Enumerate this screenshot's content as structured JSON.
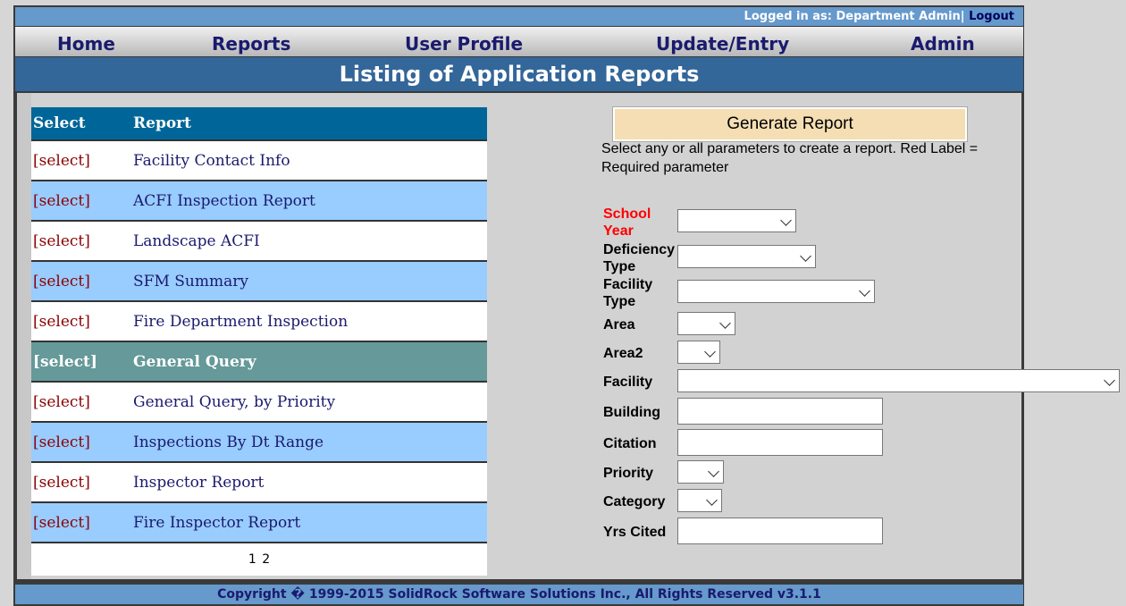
{
  "header": {
    "login_text": "Logged in as: Department Admin|",
    "logout": "Logout"
  },
  "nav": [
    "Home",
    "Reports",
    "User Profile",
    "Update/Entry",
    "Admin"
  ],
  "title": "Listing of Application Reports",
  "reports_table": {
    "headers": [
      "Select",
      "Report"
    ],
    "select_label": "[select]",
    "rows": [
      "Facility Contact Info",
      "ACFI Inspection Report",
      "Landscape ACFI",
      "SFM Summary",
      "Fire Department Inspection",
      "General Query",
      "General Query, by Priority",
      "Inspections By Dt Range",
      "Inspector Report",
      "Fire Inspector Report"
    ],
    "selected_row": "General Query",
    "pages": [
      "1",
      "2"
    ]
  },
  "generate_button": "Generate Report",
  "instructions": "Select any or all parameters to create a report. Red Label = Required parameter",
  "params": {
    "school_year": "School Year",
    "deficiency_type": "Deficiency Type",
    "facility_type": "Facility Type",
    "area": "Area",
    "area2": "Area2",
    "facility": "Facility",
    "building": "Building",
    "citation": "Citation",
    "priority": "Priority",
    "category": "Category",
    "yrs_cited": "Yrs Cited"
  },
  "footer": "Copyright � 1999-2015 SolidRock Software Solutions Inc., All Rights Reserved v3.1.1",
  "colors": {
    "topbar": "#6699cc",
    "title_bar": "#336699",
    "table_header": "#006699",
    "row_alt": "#99ccff",
    "row_selected": "#669999",
    "generate_button": "#f5deb3",
    "required_label": "#ff0000"
  }
}
